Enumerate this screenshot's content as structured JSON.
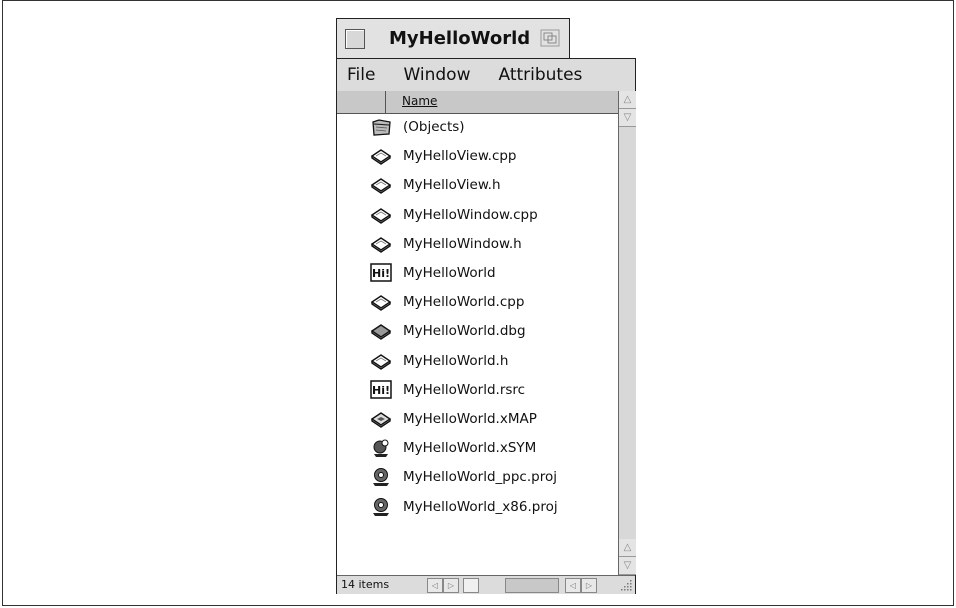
{
  "window": {
    "title": "MyHelloWorld"
  },
  "menubar": {
    "items": [
      "File",
      "Window",
      "Attributes"
    ]
  },
  "list_header": {
    "name_label": "Name"
  },
  "files": [
    {
      "label": "(Objects)",
      "icon": "folder-icon"
    },
    {
      "label": "MyHelloView.cpp",
      "icon": "source-file-icon"
    },
    {
      "label": "MyHelloView.h",
      "icon": "source-file-icon"
    },
    {
      "label": "MyHelloWindow.cpp",
      "icon": "source-file-icon"
    },
    {
      "label": "MyHelloWindow.h",
      "icon": "source-file-icon"
    },
    {
      "label": "MyHelloWorld",
      "icon": "hi-app-icon"
    },
    {
      "label": "MyHelloWorld.cpp",
      "icon": "source-file-icon"
    },
    {
      "label": "MyHelloWorld.dbg",
      "icon": "debug-file-icon"
    },
    {
      "label": "MyHelloWorld.h",
      "icon": "source-file-icon"
    },
    {
      "label": "MyHelloWorld.rsrc",
      "icon": "hi-app-icon"
    },
    {
      "label": "MyHelloWorld.xMAP",
      "icon": "map-file-icon"
    },
    {
      "label": "MyHelloWorld.xSYM",
      "icon": "sym-file-icon"
    },
    {
      "label": "MyHelloWorld_ppc.proj",
      "icon": "project-file-icon"
    },
    {
      "label": "MyHelloWorld_x86.proj",
      "icon": "project-file-icon"
    }
  ],
  "status": {
    "item_count": "14 items"
  }
}
